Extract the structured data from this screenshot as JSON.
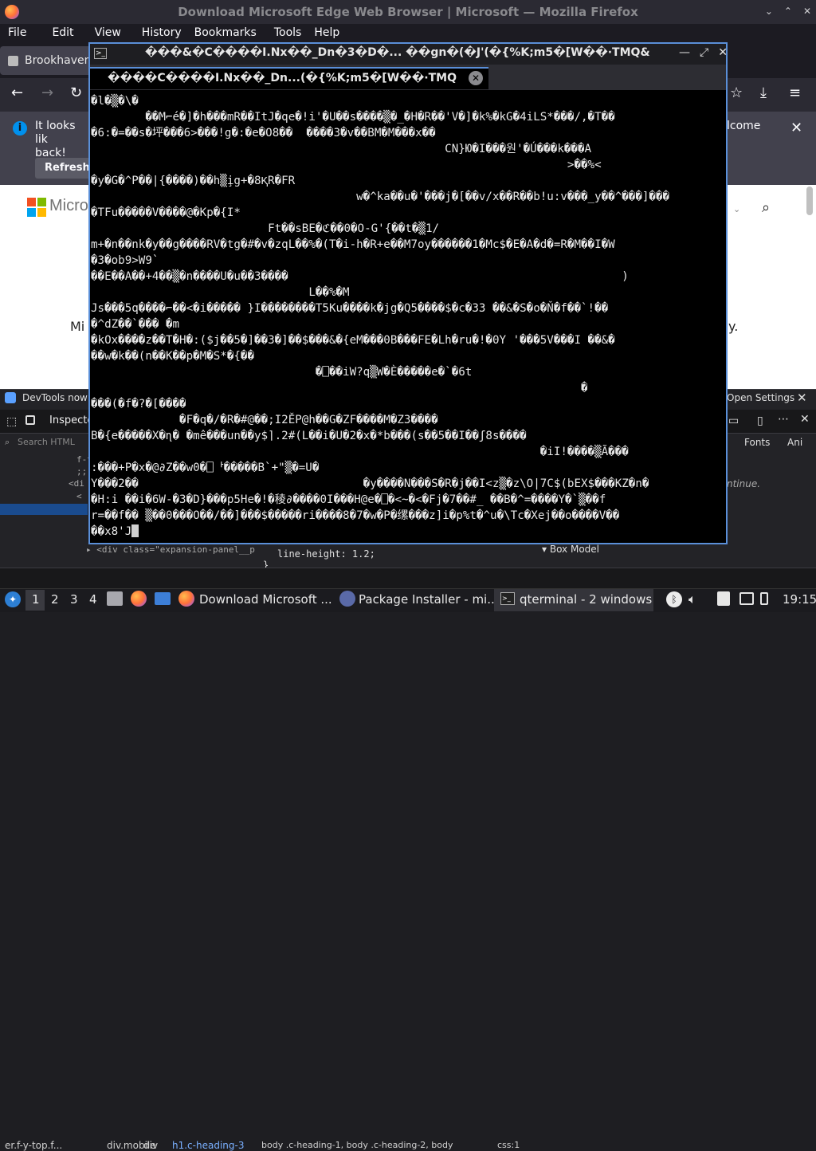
{
  "firefox": {
    "window_title": "Download Microsoft Edge Web Browser | Microsoft — Mozilla Firefox",
    "window_controls": [
      "⌄",
      "⌃",
      "✕"
    ],
    "menu": [
      "File",
      "Edit",
      "View",
      "History",
      "Bookmarks",
      "Tools",
      "Help"
    ],
    "tab_title": "Brookhaven",
    "notification": {
      "text_left": "It looks lik",
      "text_left2": "back!",
      "refresh_label": "Refresh",
      "text_right": "lcome"
    },
    "page": {
      "brand_text": "Micro",
      "heading_fragment": "Mi",
      "heading_end": "y."
    },
    "devtools": {
      "banner_text": "DevTools now f",
      "banner_settings": "Open Settings",
      "inspector_tab": "Inspecto",
      "search_placeholder": "Search HTML",
      "tree_lines": [
        "f-tr",
        ";;",
        "<di",
        "<"
      ],
      "right_tabs": [
        "Fonts",
        "Ani"
      ],
      "continue_text": "ntinue.",
      "box_model": "Box Model",
      "css_line1": "line-height: 1.2;",
      "css_line2": "}",
      "expansion_line": "<div class=\"expansion-panel__p",
      "breadcrumbs": [
        "er.f-y-top.f...",
        "div.mobile",
        "div",
        "h1.c-heading-3"
      ],
      "selector_text": "body .c-heading-1, body .c-heading-2, body",
      "css_file": "css:1"
    }
  },
  "terminal": {
    "title": "���&�C����I.Nx��_Dn�3�D�...   ��gn�(�J'(�{%K;m5�[W��⋅TMQ&",
    "tab_label": "����C����I.Nx��_Dn...(�{%K;m5�[W��⋅TMQ",
    "lines": [
      "�l�▒�\\�",
      "        ��M⌐é�]�h���mR��ItJ�qe�!i'�U��s����▒�_�H�R��'V�]�k%�kG�4iLS*���/,�T��",
      "�6:�=��s�坪���6>���!g�:�e�O8��  ����3�v��BM�M���x��",
      "                                                    CN}Ю�I���원'�Ú���k���A",
      "                                                                      >��%<",
      "�y�G�^P��|{����)��h▒i̧g+�8ⱩR�FR",
      "                                       w�^ka��u�'���j�[��v/x��R��b!u:v���_y��^���]���",
      "�TFu�����V����@�Kp�{I*",
      "                          Ft��sBE�ℭ��0�O-G'{��t�▒1/",
      "m+�n��nk�y��g����RV�tg�#�v�zqL��%�(T�i-h�R+e��M7oy������1�Mc$�E�A�d�=R�M��I�W",
      "�3�ob9>W9`",
      "��E��A��+4��▒�n����U�u��3����                                                 )",
      "                                L��%�M",
      "Js���5q����⌐��<�i����� }I��������T5Ku����k�jg�Q5����$�c�33 ��&�S�o�Ň�f��`!��",
      "�^dZ��`��� �m",
      "�kOx����z��T�H�:($j��5�]��3�]��$���&�{eM���0B���FE�Lh�ru�!�0Y '���5V���I ��&�",
      "��w�k��(n��K��p�M�S*�{��",
      "                                 �⎕��iW?q▒W�È�����e�`�6t",
      "                                                                        �",
      "���(�f�?�[����",
      "             �F�q�/�R�#@��;I2ĚP@h��G�ZF����M�Z3����",
      "B�{e�����X�ɳ� �mê���un��y$⌉.2#(L��i�U�2�x�*b���(s��5��I��ʃ8s����",
      "                                                                  �iI!����▒Ã���",
      ":���+P�x�@∂Z��w0�⎕ᅡ�����B`+\"▒�=U�",
      "Y���2��                                 �y����N���S�R�j��I<z▒�z\\O|7C$(bEX$���KZ�n�",
      "�H:i ��i�6W-�3�D}���p5He�!�稜∂����0I���H@e�⎕�<~�<�Fj�7��#_ ��B�^=����Y�`▒��f",
      "r=��f�� ▒��0���O��/��]���$�����ri����8�7�w�P�缧���z]i�p%t�^u�\\Tc�Xej��o����V��",
      "��x8'J"
    ]
  },
  "taskbar": {
    "workspaces": [
      "1",
      "2",
      "3",
      "4"
    ],
    "windows": [
      "Download Microsoft ...",
      "Package Installer - mi...",
      "qterminal - 2 windows"
    ],
    "clock": "19:15"
  }
}
